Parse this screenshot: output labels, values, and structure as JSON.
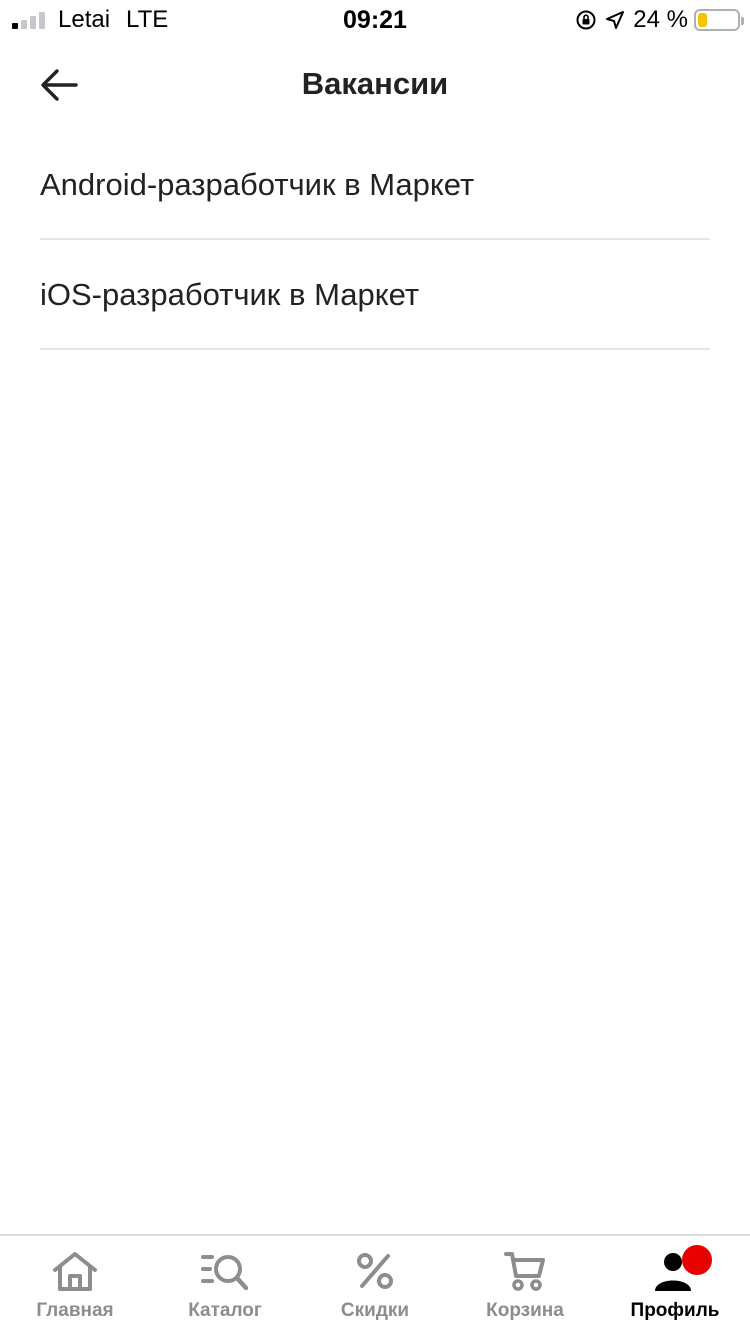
{
  "status_bar": {
    "carrier": "Letai",
    "network": "LTE",
    "time": "09:21",
    "battery_percent": "24 %",
    "signal_bars_active": 1,
    "icons": [
      "signal-icon",
      "orientation-lock-icon",
      "location-arrow-icon",
      "battery-icon"
    ]
  },
  "header": {
    "title": "Вакансии",
    "back_icon": "arrow-left-icon"
  },
  "vacancies": [
    {
      "label": "Android-разработчик в Маркет"
    },
    {
      "label": "iOS-разработчик в Маркет"
    }
  ],
  "tab_bar": {
    "active": "profile",
    "accent_color": "#e60000",
    "tabs": [
      {
        "id": "home",
        "label": "Главная",
        "icon": "home-icon"
      },
      {
        "id": "catalog",
        "label": "Каталог",
        "icon": "catalog-search-icon"
      },
      {
        "id": "discounts",
        "label": "Скидки",
        "icon": "percent-icon"
      },
      {
        "id": "cart",
        "label": "Корзина",
        "icon": "cart-icon"
      },
      {
        "id": "profile",
        "label": "Профиль",
        "icon": "profile-icon"
      }
    ]
  }
}
